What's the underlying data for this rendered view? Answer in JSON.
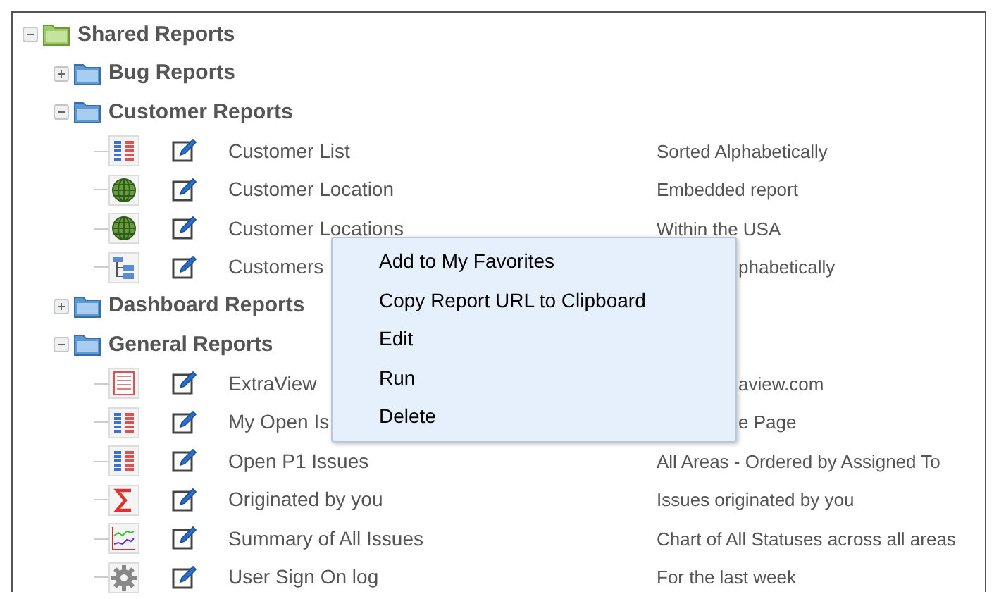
{
  "tree": {
    "label": "Shared Reports",
    "kind": "shared",
    "expanded": true,
    "children": [
      {
        "label": "Bug Reports",
        "expanded": false
      },
      {
        "label": "Customer Reports",
        "expanded": true,
        "children": [
          {
            "kind": "list",
            "name": "Customer List",
            "description": "Sorted Alphabetically",
            "covered": false
          },
          {
            "kind": "globe",
            "name": "Customer Location",
            "description": "Embedded report",
            "covered": false
          },
          {
            "kind": "globe",
            "name": "Customer Locations",
            "description": "Within the USA",
            "covered": false
          },
          {
            "kind": "hierarchy",
            "name": "Customers",
            "description": "phabetically",
            "covered": true
          }
        ]
      },
      {
        "label": "Dashboard Reports",
        "expanded": false
      },
      {
        "label": "General Reports",
        "expanded": true,
        "children": [
          {
            "kind": "form",
            "name": "ExtraView",
            "description": "aview.com",
            "covered": true
          },
          {
            "kind": "list",
            "name": "My Open Is",
            "description": "e Page",
            "covered": true
          },
          {
            "kind": "list",
            "name": "Open P1 Issues",
            "description": "All Areas - Ordered by Assigned To",
            "covered": false
          },
          {
            "kind": "sigma",
            "name": "Originated by you",
            "description": "Issues originated by you",
            "covered": false
          },
          {
            "kind": "chart",
            "name": "Summary of All Issues",
            "description": "Chart of All Statuses across all areas",
            "covered": false
          },
          {
            "kind": "gear",
            "name": "User Sign On log",
            "description": "For the last week",
            "covered": false
          }
        ]
      }
    ]
  },
  "context_menu": {
    "items": [
      "Add to My Favorites",
      "Copy Report URL to Clipboard",
      "Edit",
      "Run",
      "Delete"
    ]
  }
}
